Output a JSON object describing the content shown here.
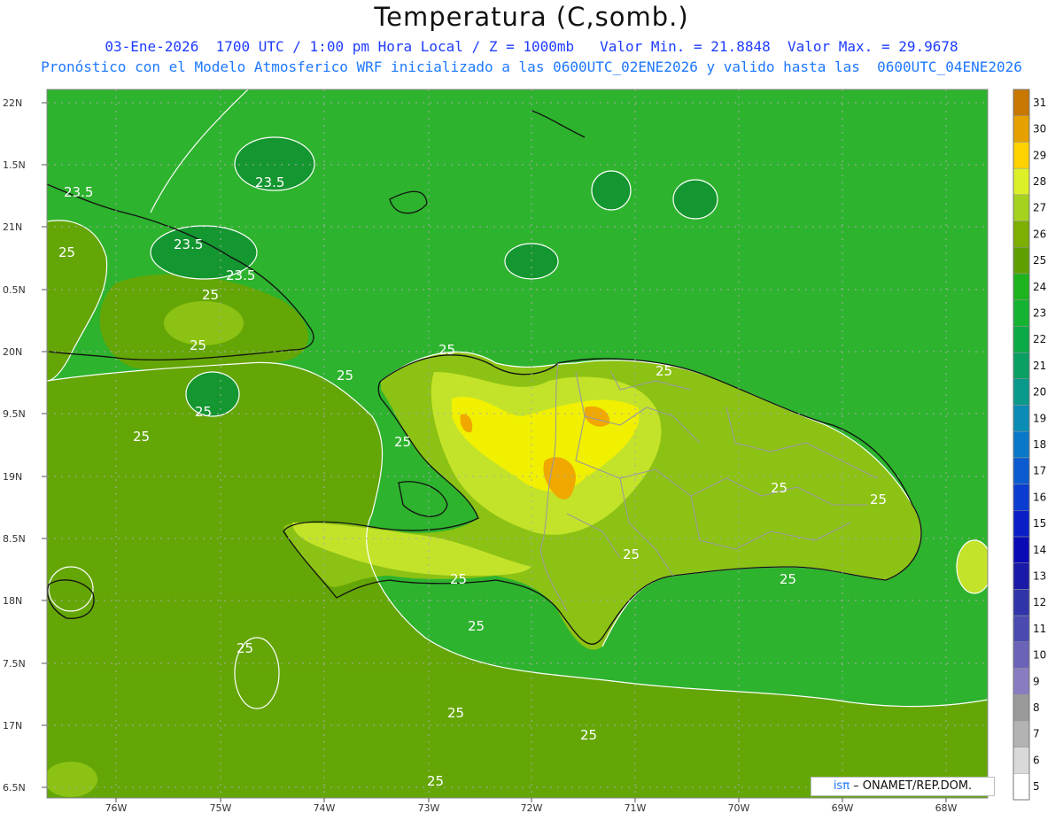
{
  "title": "Temperatura (C,somb.)",
  "subtitle1": "03-Ene-2026  1700 UTC / 1:00 pm Hora Local / Z = 1000mb   Valor Min. = 21.8848  Valor Max. = 29.9678",
  "subtitle2": "Pronóstico con el Modelo Atmosferico WRF inicializado a las 0600UTC_02ENE2026 y valido hasta las  0600UTC_04ENE2026",
  "credit": {
    "logo": "isπ",
    "text": " – ONAMET/REP.DOM."
  },
  "lat_labels": [
    "22N",
    "1.5N",
    "21N",
    "0.5N",
    "20N",
    "9.5N",
    "19N",
    "8.5N",
    "18N",
    "7.5N",
    "17N",
    "6.5N"
  ],
  "lon_labels": [
    "76W",
    "75W",
    "74W",
    "73W",
    "72W",
    "71W",
    "70W",
    "69W",
    "68W"
  ],
  "contour_labels": [
    "23.5",
    "23.5",
    "23.5",
    "23.5",
    "25",
    "25",
    "25",
    "25",
    "25",
    "25",
    "25",
    "25",
    "25",
    "25",
    "25",
    "25",
    "25",
    "25",
    "25",
    "25",
    "25",
    "25",
    "25"
  ],
  "colorbar": {
    "labels": [
      "5",
      "6",
      "7",
      "8",
      "9",
      "10",
      "11",
      "12",
      "13",
      "14",
      "15",
      "16",
      "17",
      "18",
      "19",
      "20",
      "21",
      "22",
      "23",
      "24",
      "25",
      "26",
      "27",
      "28",
      "29",
      "30",
      "31"
    ],
    "colors": [
      "#ffffff",
      "#d9d9d9",
      "#b3b3b3",
      "#9a9a9a",
      "#8a7cc0",
      "#6a63b8",
      "#4b4ab0",
      "#2f34a8",
      "#1a1aa8",
      "#0a0ab4",
      "#0a1ec8",
      "#0a3cd0",
      "#0a5ad0",
      "#0a78c8",
      "#0a8cb4",
      "#0a9a8c",
      "#0aa064",
      "#0aaa46",
      "#14b432",
      "#1eb41e",
      "#5fa000",
      "#7daf00",
      "#a5d21e",
      "#dcf028",
      "#ffd200",
      "#e6a000",
      "#c87800"
    ]
  },
  "colors": {
    "sea": "#2db32d",
    "sea_warm": "#64a606",
    "land": "#8cc214",
    "land_warm": "#c3e32a",
    "hot": "#f0f000",
    "hottest": "#f0a800",
    "cool": "#149630"
  }
}
